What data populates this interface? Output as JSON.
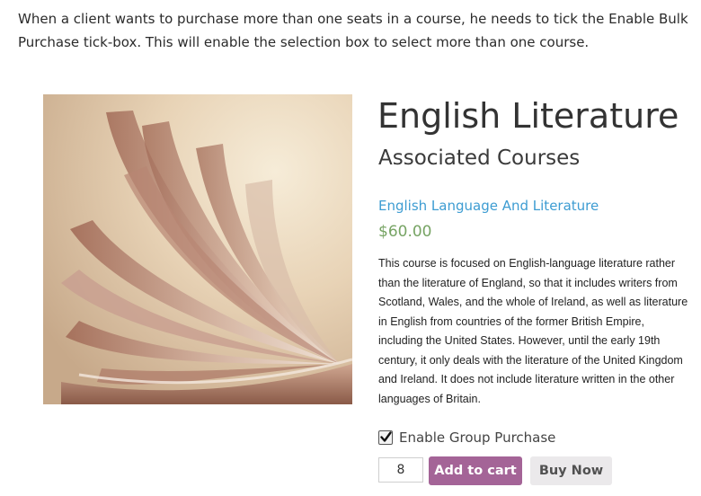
{
  "intro_text": "When a client wants to purchase more than one seats in a course, he needs to tick the Enable Bulk Purchase tick-box. This will enable the selection box to select more than one course.",
  "product": {
    "title": "English Literature",
    "subtitle": "Associated Courses",
    "course_link": "English Language And Literature",
    "price": "$60.00",
    "description": "This course is focused on English-language literature rather than the literature of England, so that it includes writers from Scotland, Wales, and the whole of Ireland, as well as literature in English from countries of the former British Empire, including the United States. However, until the early 19th century, it only deals with the literature of the United Kingdom and Ireland. It does not include literature written in the other languages of Britain.",
    "image_icon": "open-book-photo"
  },
  "purchase": {
    "group_purchase_label": "Enable Group Purchase",
    "group_purchase_checked": true,
    "quantity": "8",
    "add_to_cart_label": "Add to cart",
    "buy_now_label": "Buy Now"
  },
  "colors": {
    "link": "#3d9cd2",
    "price": "#77a464",
    "add_to_cart_bg": "#a46497",
    "buy_now_bg": "#ebe9eb"
  }
}
